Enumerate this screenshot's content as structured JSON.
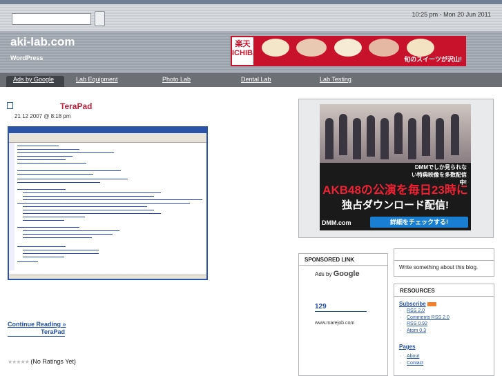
{
  "topbar": {
    "search_placeholder": "",
    "datetime": "10:25 pm - Mon 20 Jun 2011"
  },
  "header": {
    "title": "aki-lab.com",
    "subtitle": "WordPress"
  },
  "banner": {
    "logo_text": "楽天 ICHIBA",
    "promo_text": "旬のスイーツが沢山!"
  },
  "nav": {
    "tabs": [
      {
        "label": "Ads by Google"
      },
      {
        "label": "Lab Equipment"
      },
      {
        "label": "Photo Lab"
      },
      {
        "label": "Dental Lab"
      },
      {
        "label": "Lab Testing"
      }
    ]
  },
  "post": {
    "title": "TeraPad",
    "date": "21 12  2007 @ 8:18 pm",
    "continue_label": "Continue Reading »",
    "continue_post": "TeraPad",
    "rating_text": "(No Ratings Yet)"
  },
  "sidebar_ad": {
    "caption": "DMMでしか見られない特典映像を多数配信中!",
    "headline": "AKB48の公演を毎日23時に",
    "subline": "独占ダウンロード配信!",
    "brand": "DMM.com",
    "button": "詳細をチェックする!"
  },
  "sponsored": {
    "heading": "SPONSORED LINK",
    "ads_by": "Ads by",
    "ads_brand": "Google",
    "link": "129",
    "url": "www.marejob.com"
  },
  "about": {
    "text": "Write something about this blog."
  },
  "resources": {
    "heading": "RESOURCES",
    "subscribe": "Subscribe",
    "feeds": [
      "RSS 2.0",
      "Comments RSS 2.0",
      "RSS 0.92",
      "Atom 0.3"
    ],
    "pages_heading": "Pages",
    "pages": [
      "About",
      "Contact"
    ]
  }
}
